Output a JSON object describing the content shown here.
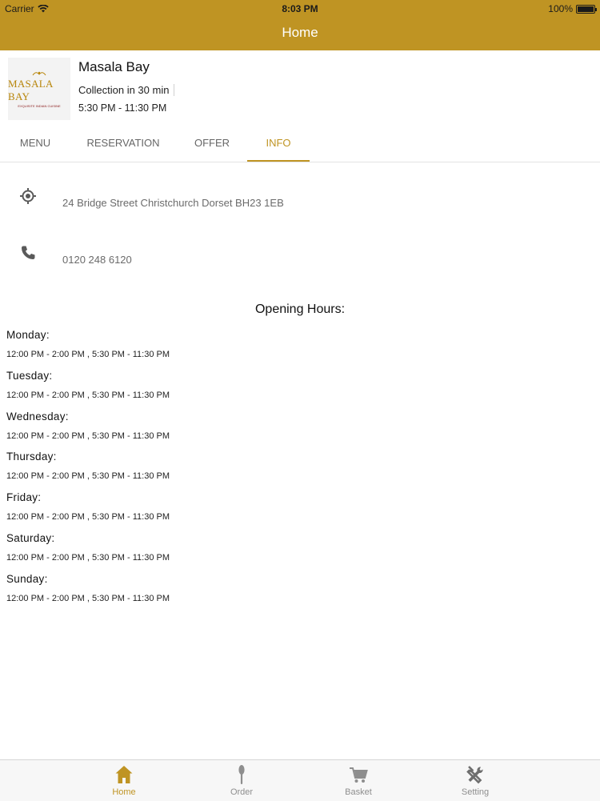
{
  "status_bar": {
    "carrier": "Carrier",
    "time": "8:03 PM",
    "battery": "100%"
  },
  "nav": {
    "title": "Home"
  },
  "restaurant": {
    "name": "Masala Bay",
    "collection": "Collection in 30 min",
    "hours": "5:30 PM - 11:30 PM",
    "logo_text": "MASALA BAY",
    "logo_subtext": "EXQUISITE INDIAN CUISINE"
  },
  "tabs": [
    {
      "label": "MENU"
    },
    {
      "label": "RESERVATION"
    },
    {
      "label": "OFFER"
    },
    {
      "label": "INFO",
      "active": true
    }
  ],
  "info": {
    "address": "24 Bridge Street Christchurch Dorset BH23 1EB",
    "address_icon": "location-target-icon",
    "phone": "0120 248 6120",
    "phone_icon": "phone-icon"
  },
  "opening_hours": {
    "title": "Opening Hours:",
    "days": [
      {
        "day": "Monday:",
        "times": "12:00 PM - 2:00 PM , 5:30 PM - 11:30 PM"
      },
      {
        "day": "Tuesday:",
        "times": "12:00 PM - 2:00 PM , 5:30 PM - 11:30 PM"
      },
      {
        "day": "Wednesday:",
        "times": "12:00 PM - 2:00 PM , 5:30 PM - 11:30 PM"
      },
      {
        "day": "Thursday:",
        "times": "12:00 PM - 2:00 PM , 5:30 PM - 11:30 PM"
      },
      {
        "day": "Friday:",
        "times": "12:00 PM - 2:00 PM , 5:30 PM - 11:30 PM"
      },
      {
        "day": "Saturday:",
        "times": "12:00 PM - 2:00 PM , 5:30 PM - 11:30 PM"
      },
      {
        "day": "Sunday:",
        "times": "12:00 PM - 2:00 PM , 5:30 PM - 11:30 PM"
      }
    ]
  },
  "tabbar": [
    {
      "label": "Home",
      "icon": "home-icon",
      "active": true
    },
    {
      "label": "Order",
      "icon": "spoon-icon"
    },
    {
      "label": "Basket",
      "icon": "cart-icon"
    },
    {
      "label": "Setting",
      "icon": "tools-icon"
    }
  ],
  "colors": {
    "accent": "#bf9423",
    "header_text": "#ffffff",
    "muted_text": "#6b6b6b"
  }
}
